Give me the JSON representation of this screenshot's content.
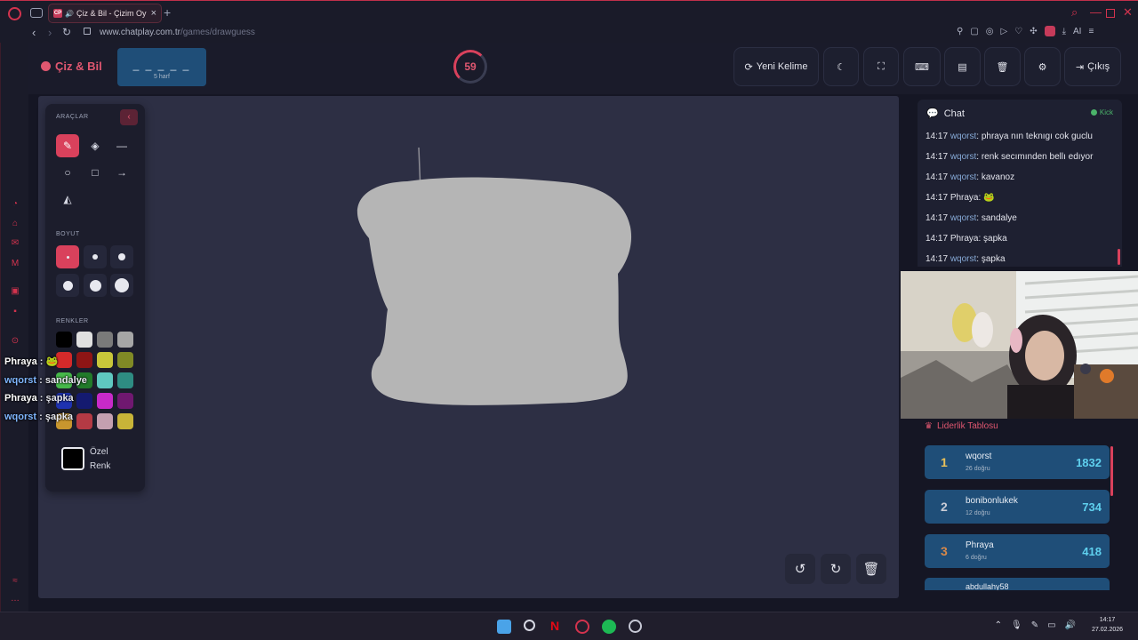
{
  "browser": {
    "tab_title": "Çiz & Bil - Çizim Oy",
    "tab_favicon": "CP",
    "url_host": "www.chatplay.com.tr",
    "url_path": "/games/drawguess",
    "ai_label": "AI"
  },
  "header": {
    "brand": "Çiz & Bil",
    "word_mask": "_ _ _ _ _",
    "word_hint": "5 harf",
    "timer": "59",
    "new_word": "Yeni Kelime",
    "exit": "Çıkış"
  },
  "tools": {
    "tools_label": "ARAÇLAR",
    "size_label": "BOYUT",
    "colors_label": "RENKLER",
    "custom_color_label": "Özel Renk",
    "selected_tool": "brush",
    "selected_size_index": 0,
    "palette": [
      "#000000",
      "#e0e0e0",
      "#7a7a7a",
      "#a6a6a6",
      "#d42a2a",
      "#8e1515",
      "#c8c63a",
      "#808a25",
      "#46b84a",
      "#227a2a",
      "#5fc8c0",
      "#2e8c82",
      "#1e32b0",
      "#141a70",
      "#c82ac8",
      "#701870",
      "#c8962e",
      "#b43a44",
      "#c4a0b0",
      "#c8b438"
    ],
    "custom_color": "#000000"
  },
  "overlay_chat": [
    {
      "user": "Phraya",
      "text": "🐸"
    },
    {
      "user": "wqorst",
      "text": "sandalye"
    },
    {
      "user": "Phraya",
      "text": "şapka"
    },
    {
      "user": "wqorst",
      "text": "şapka"
    }
  ],
  "chat": {
    "title": "Chat",
    "platform": "Kick",
    "messages": [
      {
        "time": "14:17",
        "user": "wqorst",
        "text": ": phraya nın teknıgı cok guclu"
      },
      {
        "time": "14:17",
        "user": "wqorst",
        "text": ": renk secımınden bellı edıyor"
      },
      {
        "time": "14:17",
        "user": "wqorst",
        "text": ": kavanoz"
      },
      {
        "time": "14:17",
        "user": "Phraya",
        "text": ": 🐸"
      },
      {
        "time": "14:17",
        "user": "wqorst",
        "text": ": sandalye"
      },
      {
        "time": "14:17",
        "user": "Phraya",
        "text": ": şapka"
      },
      {
        "time": "14:17",
        "user": "wqorst",
        "text": ": şapka"
      }
    ]
  },
  "leaderboard": {
    "title": "Liderlik Tablosu",
    "entries": [
      {
        "rank": "1",
        "name": "wqorst",
        "correct": "26 doğru",
        "score": "1832",
        "rank_color": "#e9c15a"
      },
      {
        "rank": "2",
        "name": "bonibonlukek",
        "correct": "12 doğru",
        "score": "734",
        "rank_color": "#c9ccd6"
      },
      {
        "rank": "3",
        "name": "Phraya",
        "correct": "6 doğru",
        "score": "418",
        "rank_color": "#d8894a"
      }
    ],
    "partial_name": "abdullahy58"
  },
  "taskbar": {
    "time": "14:17",
    "date": "27.02.2026"
  },
  "colors": {
    "accent": "#d9415c",
    "card": "#1f4e78",
    "canvas": "#2d2f44",
    "shape_fill": "#b5b5b5"
  }
}
